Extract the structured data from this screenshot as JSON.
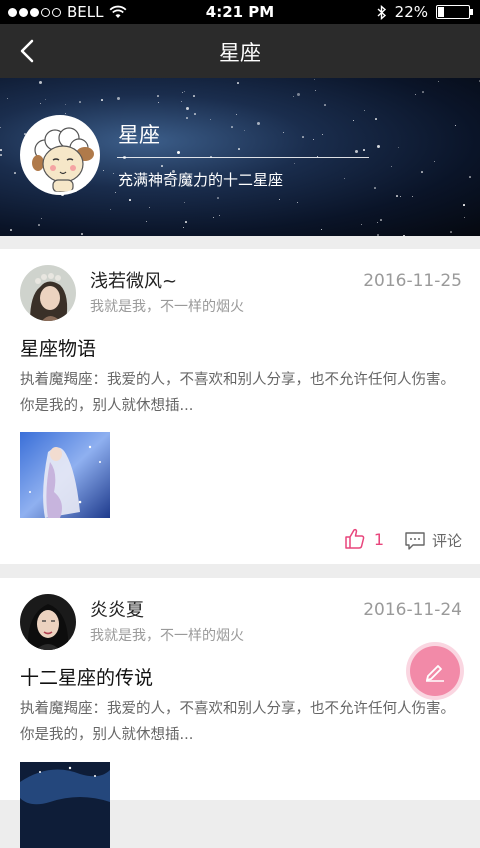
{
  "status": {
    "carrier": "BELL",
    "time": "4:21 PM",
    "battery": "22%",
    "battery_level": 0.22
  },
  "nav": {
    "title": "星座",
    "back_icon": "chevron-left-icon"
  },
  "banner": {
    "name": "星座",
    "description": "充满神奇魔力的十二星座"
  },
  "posts": [
    {
      "author": "浅若微风~",
      "signature": "我就是我，不一样的烟火",
      "date": "2016-11-25",
      "title": "星座物语",
      "excerpt": "执着魔羯座：我爱的人，不喜欢和别人分享，也不允许任何人伤害。你是我的，别人就休想插...",
      "likes": "1",
      "comment_label": "评论"
    },
    {
      "author": "炎炎夏",
      "signature": "我就是我，不一样的烟火",
      "date": "2016-11-24",
      "title": "十二星座的传说",
      "excerpt": "执着魔羯座：我爱的人，不喜欢和别人分享，也不允许任何人伤害。你是我的，别人就休想插..."
    }
  ],
  "colors": {
    "nav_bg": "#2b2b2b",
    "accent_pink": "#e8457c",
    "fab": "#f28aa8"
  },
  "fab_icon": "edit-pencil-icon"
}
